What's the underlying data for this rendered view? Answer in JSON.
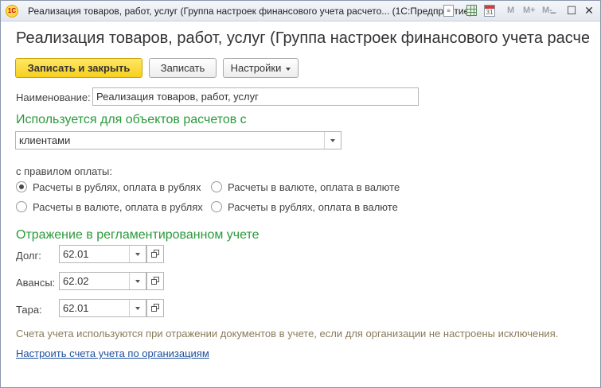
{
  "window": {
    "title": "Реализация товаров, работ, услуг (Группа настроек финансового учета расчето...  (1С:Предприятие)",
    "logo_text": "1С",
    "toolbar_icons": [
      "document-icon",
      "spreadsheet-icon",
      "calendar-icon"
    ],
    "calendar_day": "31",
    "memory_buttons": [
      "M",
      "M+",
      "M-"
    ],
    "controls": {
      "minimize": "—",
      "maximize": "☐",
      "close": "✕"
    }
  },
  "form": {
    "title": "Реализация товаров, работ, услуг (Группа настроек финансового учета расчетов...",
    "buttons": {
      "save_close": "Записать и закрыть",
      "save": "Записать",
      "settings": "Настройки"
    },
    "name_label": "Наименование:",
    "name_value": "Реализация товаров, работ, услуг",
    "used_for_title": "Используется для объектов расчетов с",
    "counterparty_value": "клиентами",
    "payment_rule_label": "с правилом оплаты:",
    "payment_rules": [
      {
        "label": "Расчеты в рублях, оплата в рублях",
        "checked": true
      },
      {
        "label": "Расчеты в валюте, оплата в валюте",
        "checked": false
      },
      {
        "label": "Расчеты в валюте, оплата в рублях",
        "checked": false
      },
      {
        "label": "Расчеты в рублях, оплата в валюте",
        "checked": false
      }
    ],
    "accounting_title": "Отражение в регламентированном учете",
    "accounts": [
      {
        "label": "Долг:",
        "value": "62.01"
      },
      {
        "label": "Авансы:",
        "value": "62.02"
      },
      {
        "label": "Тара:",
        "value": "62.01"
      }
    ],
    "hint": "Счета учета используются при отражении документов в учете, если для организации не настроены исключения.",
    "link": "Настроить счета учета по организациям"
  },
  "colors": {
    "accent_green": "#2a9a3a",
    "primary_button": "#f7cf1e",
    "link": "#1e4f9c",
    "hint": "#8a7a5a"
  }
}
